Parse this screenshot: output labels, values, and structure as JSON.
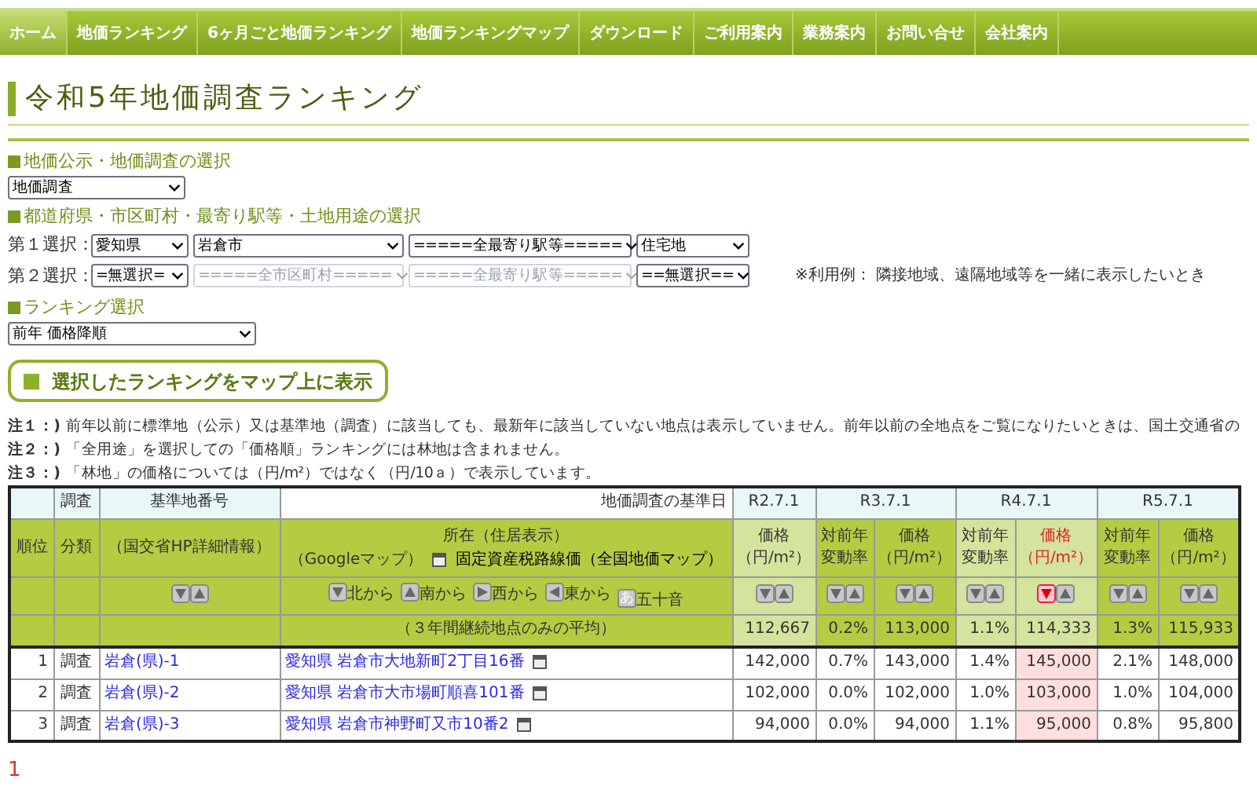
{
  "nav": [
    {
      "label": "ホーム",
      "selected": true
    },
    {
      "label": "地価ランキング",
      "selected": false
    },
    {
      "label": "6ヶ月ごと地価ランキング",
      "selected": false
    },
    {
      "label": "地価ランキングマップ",
      "selected": false
    },
    {
      "label": "ダウンロード",
      "selected": false
    },
    {
      "label": "ご利用案内",
      "selected": false
    },
    {
      "label": "業務案内",
      "selected": false
    },
    {
      "label": "お問い合せ",
      "selected": false
    },
    {
      "label": "会社案内",
      "selected": false
    }
  ],
  "page_title": "令和5年地価調査ランキング",
  "survey_section": {
    "heading": "地価公示・地価調査の選択",
    "select": {
      "value": "地価調査"
    }
  },
  "area_section": {
    "heading": "都道府県・市区町村・最寄り駅等・土地用途の選択",
    "rows": [
      {
        "label": "第１選択：",
        "selects": [
          {
            "value": "愛知県",
            "disabled": false
          },
          {
            "value": "岩倉市",
            "disabled": false
          },
          {
            "value": "=====全最寄り駅等=====",
            "disabled": false
          },
          {
            "value": "住宅地",
            "disabled": false
          }
        ]
      },
      {
        "label": "第２選択：",
        "selects": [
          {
            "value": "=無選択=",
            "disabled": false
          },
          {
            "value": "=====全市区町村=====",
            "disabled": true
          },
          {
            "value": "=====全最寄り駅等=====",
            "disabled": true
          },
          {
            "value": "==無選択==",
            "disabled": false
          }
        ]
      }
    ],
    "note": "※利用例： 隣接地域、遠隔地域等を一緒に表示したいとき"
  },
  "ranking_section": {
    "heading": "ランキング選択",
    "select": {
      "value": "前年 価格降順"
    }
  },
  "map_button": "選択したランキングをマップ上に表示",
  "notes": [
    {
      "label": "注１：)",
      "text": "前年以前に標準地（公示）又は基準地（調査）に該当しても、最新年に該当していない地点は表示していません。前年以前の全地点をご覧になりたいときは、国土交通省の"
    },
    {
      "label": "注２：)",
      "text": "「全用途」を選択しての「価格順」ランキングには林地は含まれません。"
    },
    {
      "label": "注３：)",
      "text": "「林地」の価格については（円/m²）ではなく（円/10ａ）で表示しています。"
    }
  ],
  "table": {
    "head": {
      "type_top": "調査",
      "id_top": "基準地番号",
      "date_label": "地価調査の基準日",
      "rank": "順位",
      "type": "分類",
      "id_sub": "（国交省HP詳細情報）",
      "address_title": "所在（住居表示）",
      "address_map": "（Googleマップ）",
      "address_tax": "固定資産税路線価（全国地価マップ）",
      "address_sorts": [
        {
          "kind": "down",
          "label": "北から"
        },
        {
          "kind": "up",
          "label": "南から"
        },
        {
          "kind": "right",
          "label": "西から"
        },
        {
          "kind": "left",
          "label": "東から"
        },
        {
          "kind": "kana",
          "glyph": "あ",
          "label": "五十音"
        }
      ]
    },
    "years": [
      {
        "label": "R2.7.1",
        "light": true,
        "columns": [
          {
            "lines": [
              "価格",
              "（円/m²）"
            ],
            "sorted": false
          }
        ]
      },
      {
        "label": "R3.7.1",
        "light": false,
        "columns": [
          {
            "lines": [
              "対前年",
              "変動率"
            ],
            "sorted": false
          },
          {
            "lines": [
              "価格",
              "（円/m²）"
            ],
            "sorted": false
          }
        ]
      },
      {
        "label": "R4.7.1",
        "light": true,
        "columns": [
          {
            "lines": [
              "対前年",
              "変動率"
            ],
            "sorted": false
          },
          {
            "lines": [
              "価格",
              "（円/m²）"
            ],
            "sorted": true
          }
        ]
      },
      {
        "label": "R5.7.1",
        "light": false,
        "columns": [
          {
            "lines": [
              "対前年",
              "変動率"
            ],
            "sorted": false
          },
          {
            "lines": [
              "価格",
              "（円/m²）"
            ],
            "sorted": false
          }
        ]
      }
    ],
    "average": {
      "label": "（３年間継続地点のみの平均）",
      "values": [
        "112,667",
        "0.2%",
        "113,000",
        "1.1%",
        "114,333",
        "1.3%",
        "115,933"
      ]
    },
    "rows": [
      {
        "rank": "1",
        "type": "調査",
        "id": "岩倉(県)-1",
        "address": "愛知県 岩倉市大地新町2丁目16番",
        "values": [
          "142,000",
          "0.7%",
          "143,000",
          "1.4%",
          "145,000",
          "2.1%",
          "148,000"
        ]
      },
      {
        "rank": "2",
        "type": "調査",
        "id": "岩倉(県)-2",
        "address": "愛知県 岩倉市大市場町順喜101番",
        "values": [
          "102,000",
          "0.0%",
          "102,000",
          "1.0%",
          "103,000",
          "1.0%",
          "104,000"
        ]
      },
      {
        "rank": "3",
        "type": "調査",
        "id": "岩倉(県)-3",
        "address": "愛知県 岩倉市神野町又市10番2",
        "values": [
          "94,000",
          "0.0%",
          "94,000",
          "1.1%",
          "95,000",
          "0.8%",
          "95,800"
        ]
      }
    ]
  },
  "page_number": "1"
}
